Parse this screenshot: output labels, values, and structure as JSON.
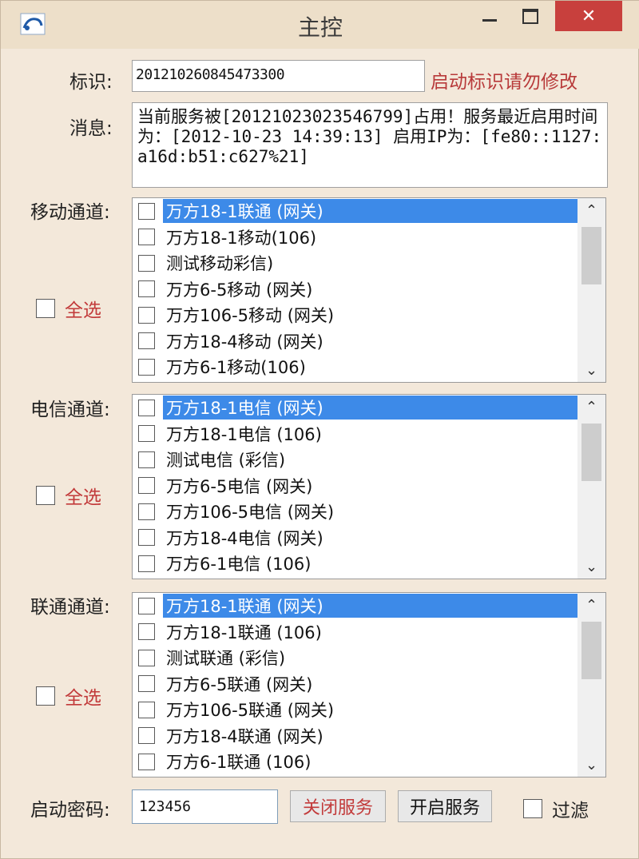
{
  "window": {
    "title": "主控",
    "close_glyph": "✕"
  },
  "identity": {
    "label": "标识:",
    "value": "201210260845473300",
    "note": "启动标识请勿修改"
  },
  "message": {
    "label": "消息:",
    "value": "当前服务被[20121023023546799]占用！服务最近启用时间为：[2012-10-23 14:39:13] 启用IP为：[fe80::1127:a16d:b51:c627%21]"
  },
  "channels": {
    "mobile": {
      "label": "移动通道:",
      "select_all": "全选",
      "items": [
        "万方18-1联通 (网关)",
        "万方18-1移动(106)",
        "测试移动彩信)",
        "万方6-5移动 (网关)",
        "万方106-5移动 (网关)",
        "万方18-4移动 (网关)",
        "万方6-1移动(106)"
      ]
    },
    "telecom": {
      "label": "电信通道:",
      "select_all": "全选",
      "items": [
        "万方18-1电信 (网关)",
        "万方18-1电信 (106)",
        "测试电信 (彩信)",
        "万方6-5电信 (网关)",
        "万方106-5电信 (网关)",
        "万方18-4电信 (网关)",
        "万方6-1电信 (106)"
      ]
    },
    "unicom": {
      "label": "联通通道:",
      "select_all": "全选",
      "items": [
        "万方18-1联通 (网关)",
        "万方18-1联通 (106)",
        "测试联通 (彩信)",
        "万方6-5联通 (网关)",
        "万方106-5联通 (网关)",
        "万方18-4联通 (网关)",
        "万方6-1联通 (106)"
      ]
    }
  },
  "footer": {
    "password_label": "启动密码:",
    "password_value": "123456",
    "stop_button": "关闭服务",
    "start_button": "开启服务",
    "filter_label": "过滤"
  },
  "colors": {
    "accent_red": "#c23a3a",
    "selection_blue": "#3d8ae8",
    "close_red": "#c8403d"
  }
}
